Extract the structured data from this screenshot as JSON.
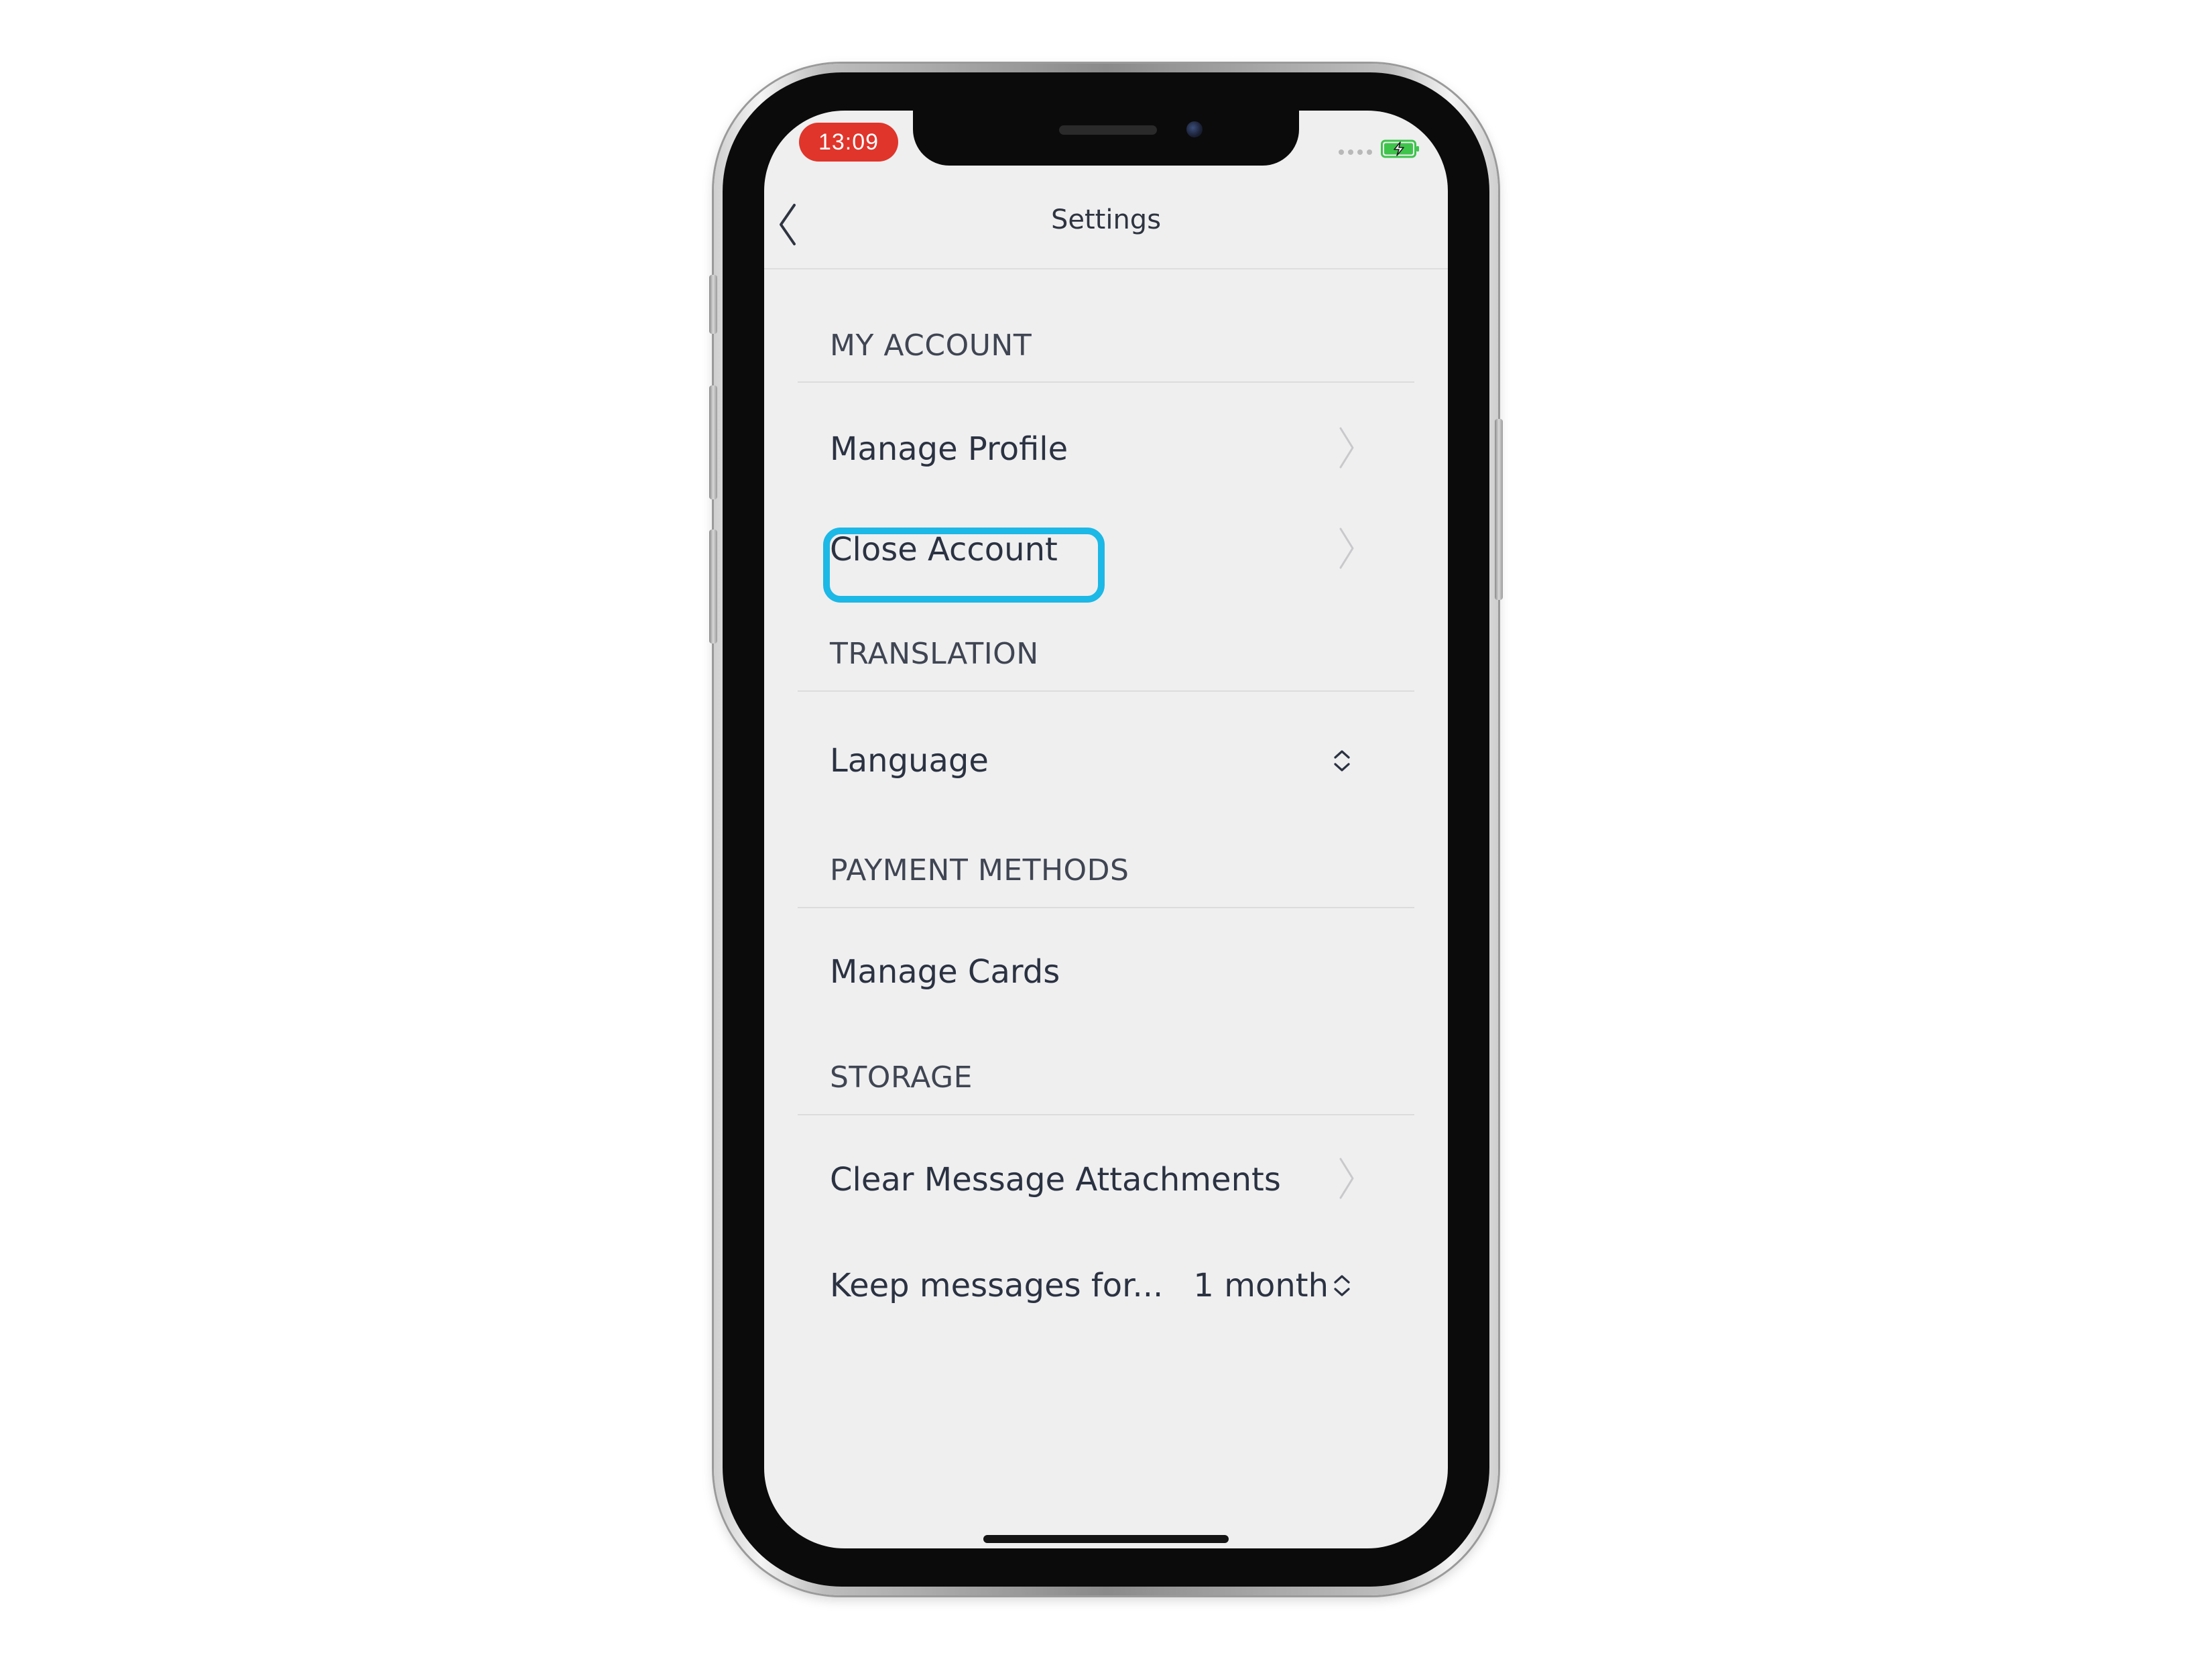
{
  "status_bar": {
    "time": "13:09"
  },
  "nav": {
    "title": "Settings"
  },
  "sections": {
    "my_account": {
      "header": "MY ACCOUNT",
      "manage_profile": "Manage Profile",
      "close_account": "Close Account"
    },
    "translation": {
      "header": "TRANSLATION",
      "language": "Language"
    },
    "payment_methods": {
      "header": "PAYMENT METHODS",
      "manage_cards": "Manage Cards"
    },
    "storage": {
      "header": "STORAGE",
      "clear_attachments": "Clear Message Attachments",
      "keep_messages": "Keep messages for...",
      "keep_messages_value": "1 month"
    }
  },
  "colors": {
    "time_pill": "#e0352b",
    "highlight": "#1cb8e6",
    "battery": "#3ec44b",
    "background": "#efeff0"
  },
  "icons": {
    "back": "chevron-left-icon",
    "disclosure": "chevron-right-icon",
    "stepper": "up-down-chevron-icon",
    "battery": "battery-charging-icon"
  }
}
